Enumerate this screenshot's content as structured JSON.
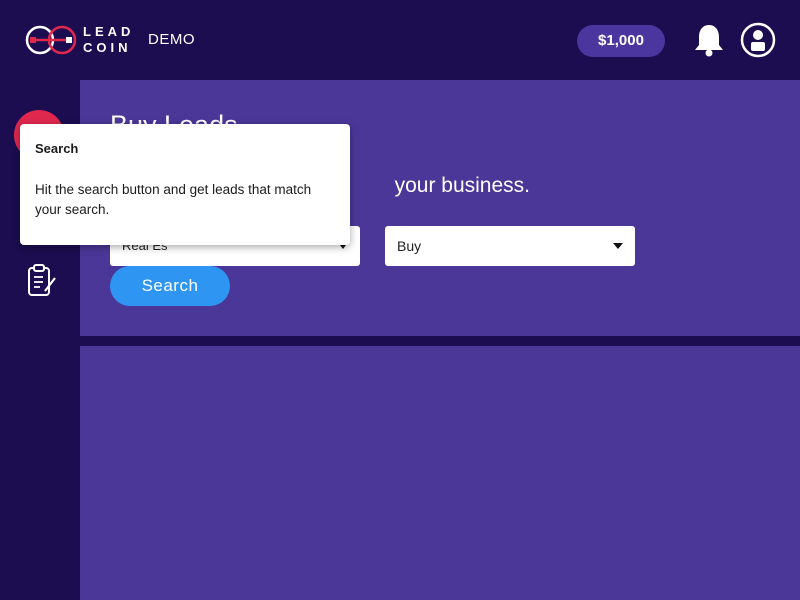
{
  "header": {
    "logo_word_1": "LEAD",
    "logo_word_2": "COIN",
    "env_label": "DEMO",
    "balance": "$1,000",
    "icons": [
      "leadcoin-logo-icon",
      "bell-icon",
      "account-icon"
    ]
  },
  "sidebar": {
    "items": [
      {
        "name": "search",
        "icon": "search-icon",
        "active": true
      },
      {
        "name": "orders",
        "icon": "clipboard-icon",
        "active": false
      }
    ]
  },
  "main": {
    "title": "Buy Leads",
    "subtitle": "your business.",
    "industry_select": {
      "value": "Real Es"
    },
    "type_select": {
      "value": "Buy"
    },
    "search_button_label": "Search"
  },
  "tooltip": {
    "title": "Search",
    "body": "Hit the search button and get leads that match your search."
  },
  "colors": {
    "background": "#1b0d4f",
    "panel": "#4b3798",
    "accent_red": "#e0284f",
    "button_blue": "#2f95f3",
    "balance_pill": "#4b36a0"
  }
}
